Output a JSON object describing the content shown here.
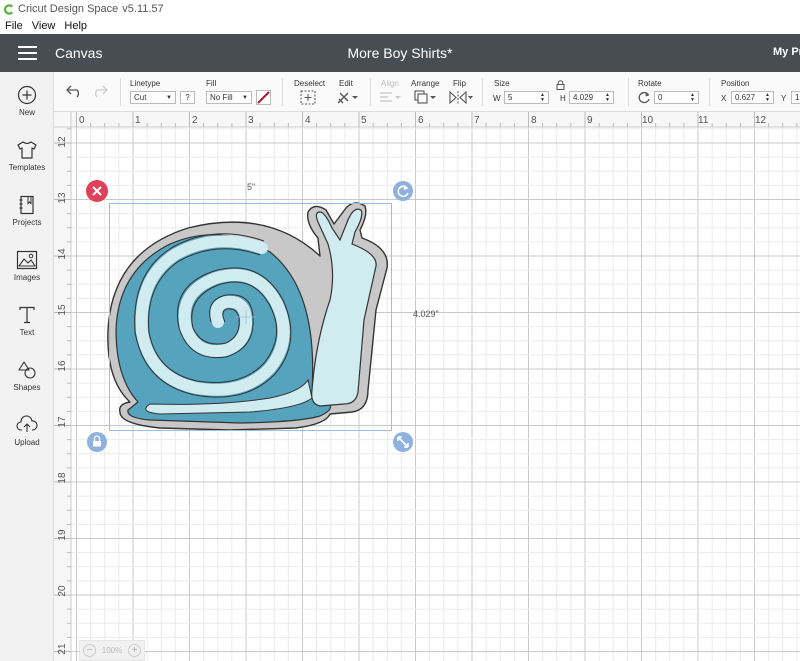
{
  "app": {
    "title": "Cricut Design Space",
    "version": "v5.11.57"
  },
  "menu": [
    "File",
    "View",
    "Help"
  ],
  "header": {
    "section": "Canvas",
    "project_name": "More Boy Shirts*",
    "my_projects": "My Pr"
  },
  "sidebar": {
    "items": [
      {
        "label": "New",
        "icon": "plus-circle-icon"
      },
      {
        "label": "Templates",
        "icon": "tshirt-icon"
      },
      {
        "label": "Projects",
        "icon": "notebook-icon"
      },
      {
        "label": "Images",
        "icon": "image-icon"
      },
      {
        "label": "Text",
        "icon": "text-t-icon"
      },
      {
        "label": "Shapes",
        "icon": "shapes-icon"
      },
      {
        "label": "Upload",
        "icon": "cloud-upload-icon"
      }
    ]
  },
  "toolbar": {
    "linetype_label": "Linetype",
    "linetype_value": "Cut",
    "linetype_help": "?",
    "fill_label": "Fill",
    "fill_value": "No Fill",
    "deselect_label": "Deselect",
    "edit_label": "Edit",
    "align_label": "Align",
    "arrange_label": "Arrange",
    "flip_label": "Flip",
    "size_label": "Size",
    "w_label": "W",
    "w_value": "5",
    "h_label": "H",
    "h_value": "4.029",
    "rotate_label": "Rotate",
    "rotate_value": "0",
    "position_label": "Position",
    "x_label": "X",
    "x_value": "0.627",
    "y_label": "Y",
    "y_value": "1"
  },
  "ruler": {
    "horizontal": [
      "0",
      "1",
      "2",
      "3",
      "4",
      "5",
      "6",
      "7",
      "8",
      "9",
      "10",
      "11",
      "12"
    ],
    "vertical": [
      "12",
      "13",
      "14",
      "15",
      "16",
      "17",
      "18",
      "19",
      "20",
      "21"
    ]
  },
  "selection": {
    "width_label": "5\"",
    "height_label": "4.029\""
  },
  "zoom": {
    "value": "100%"
  },
  "colors": {
    "header_bg": "#464e53",
    "snail_outline": "#c8c8c8",
    "snail_dark": "#56a3bd",
    "snail_light": "#d0ecf0",
    "selection": "#9bbde0",
    "delete_handle": "#e0405a",
    "handle": "#8fb1dd"
  }
}
